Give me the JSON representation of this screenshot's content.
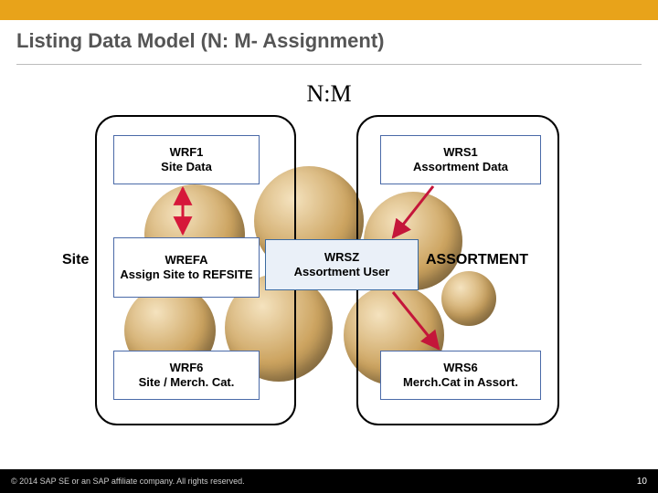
{
  "header": {
    "title": "Listing Data Model (N: M- Assignment)"
  },
  "diagram": {
    "relation_label": "N:M",
    "left_label": "Site",
    "right_label": "ASSORTMENT",
    "center": {
      "code": "WRSZ",
      "desc": "Assortment User"
    },
    "left": {
      "b1": {
        "code": "WRF1",
        "desc": "Site Data"
      },
      "b2": {
        "code": "WREFA",
        "desc": "Assign Site to REFSITE"
      },
      "b3": {
        "code": "WRF6",
        "desc": "Site / Merch. Cat."
      }
    },
    "right": {
      "b1": {
        "code": "WRS1",
        "desc": "Assortment Data"
      },
      "b3": {
        "code": "WRS6",
        "desc": "Merch.Cat in Assort."
      }
    }
  },
  "footer": {
    "copyright": "© 2014 SAP SE or an SAP affiliate company. All rights reserved.",
    "page": "10"
  },
  "colors": {
    "accent": "#e8a31a",
    "arrow_left": "#d6183a",
    "arrow_right": "#c4163a"
  }
}
